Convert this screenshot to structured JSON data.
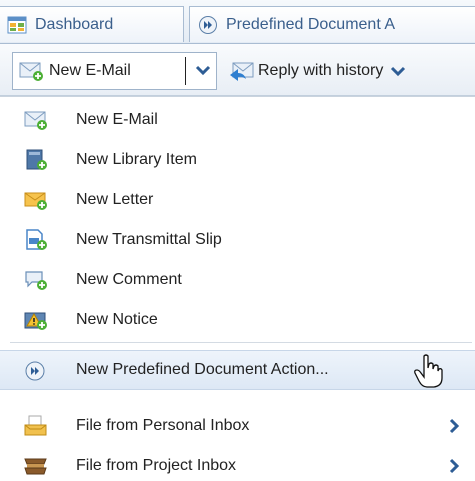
{
  "tabs": {
    "dashboard_label": "Dashboard",
    "predefined_label": "Predefined Document A"
  },
  "toolbar": {
    "new_button_label": "New E-Mail",
    "reply_button_label": "Reply with history"
  },
  "menu": {
    "items": [
      {
        "label": "New E-Mail",
        "icon": "email-icon"
      },
      {
        "label": "New Library Item",
        "icon": "library-item-icon"
      },
      {
        "label": "New Letter",
        "icon": "letter-icon"
      },
      {
        "label": "New Transmittal Slip",
        "icon": "transmittal-slip-icon"
      },
      {
        "label": "New Comment",
        "icon": "comment-icon"
      },
      {
        "label": "New Notice",
        "icon": "notice-icon"
      },
      {
        "label": "New Predefined Document Action...",
        "icon": "predefined-action-icon"
      },
      {
        "label": "File from Personal Inbox",
        "icon": "personal-inbox-icon"
      },
      {
        "label": "File from Project Inbox",
        "icon": "project-inbox-icon"
      }
    ],
    "hovered_item": "New Predefined Document Action..."
  },
  "colors": {
    "link_blue": "#3a5f8c",
    "chevron_blue": "#2e5d95",
    "hover_bg": "#dde8f5"
  }
}
